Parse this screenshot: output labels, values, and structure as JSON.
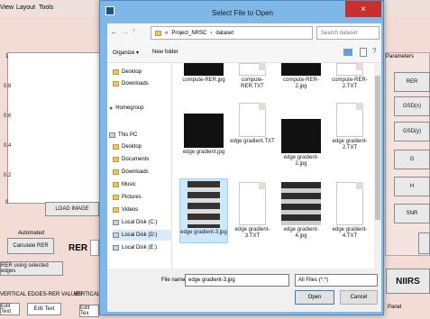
{
  "app": {
    "menu": [
      "View",
      "Layout",
      "Tools"
    ],
    "y_ticks": [
      "1",
      "0.8",
      "0.6",
      "0.4",
      "0.2",
      "0"
    ],
    "load_image": "LOAD IMAGE",
    "automated_label": "Automated",
    "calculate_rer": "Calculate RER",
    "rer_label": "RER =",
    "rer_selected_edges": "RER using selected edges",
    "vertical_edges_label": "VERTICAL EDGES-RER VALUES",
    "vertical_edges_label2": "VERTICAL E",
    "edit_text": "Edit Text",
    "edit_text_partial": "Edit Text",
    "edit_tex": "Edit Tex",
    "parameters_label": "Parameters",
    "right_buttons": [
      "RER",
      "GSD(x)",
      "GSD(y)",
      "G",
      "H",
      "SNR"
    ],
    "niirs": "NIIRS",
    "panel_label": "Panel"
  },
  "dialog": {
    "title": "Select File to Open",
    "close_icon": "×",
    "breadcrumb": [
      "Project_NRSC",
      "dataset"
    ],
    "search_placeholder": "Search dataset",
    "organize": "Organize ▾",
    "new_folder": "New folder",
    "nav": [
      {
        "label": "Desktop",
        "icon": "folder"
      },
      {
        "label": "Downloads",
        "icon": "folder"
      },
      {
        "label": "Homegroup",
        "icon": "homegroup"
      },
      {
        "label": "This PC",
        "icon": "pc"
      },
      {
        "label": "Desktop",
        "icon": "folder"
      },
      {
        "label": "Documents",
        "icon": "folder"
      },
      {
        "label": "Downloads",
        "icon": "folder"
      },
      {
        "label": "Music",
        "icon": "folder"
      },
      {
        "label": "Pictures",
        "icon": "folder"
      },
      {
        "label": "Videos",
        "icon": "folder"
      },
      {
        "label": "Local Disk (C:)",
        "icon": "disk"
      },
      {
        "label": "Local Disk (D:)",
        "icon": "disk"
      },
      {
        "label": "Local Disk (E:)",
        "icon": "disk"
      }
    ],
    "files": [
      "compute-RER.jpg",
      "compute-RER.TXT",
      "compute-RER-2.jpg",
      "compute-RER-2.TXT",
      "edge gradient.jpg",
      "edge gradient.TXT",
      "edge gradient-2.jpg",
      "edge gradient-2.TXT",
      "edge gradient-3.jpg",
      "edge gradient-3.TXT",
      "edge gradient-4.jpg",
      "edge gradient-4.TXT"
    ],
    "file_name_label": "File name:",
    "file_name_value": "edge gradient-3.jpg",
    "file_type": "All Files (*.*)",
    "open": "Open",
    "cancel": "Cancel"
  }
}
